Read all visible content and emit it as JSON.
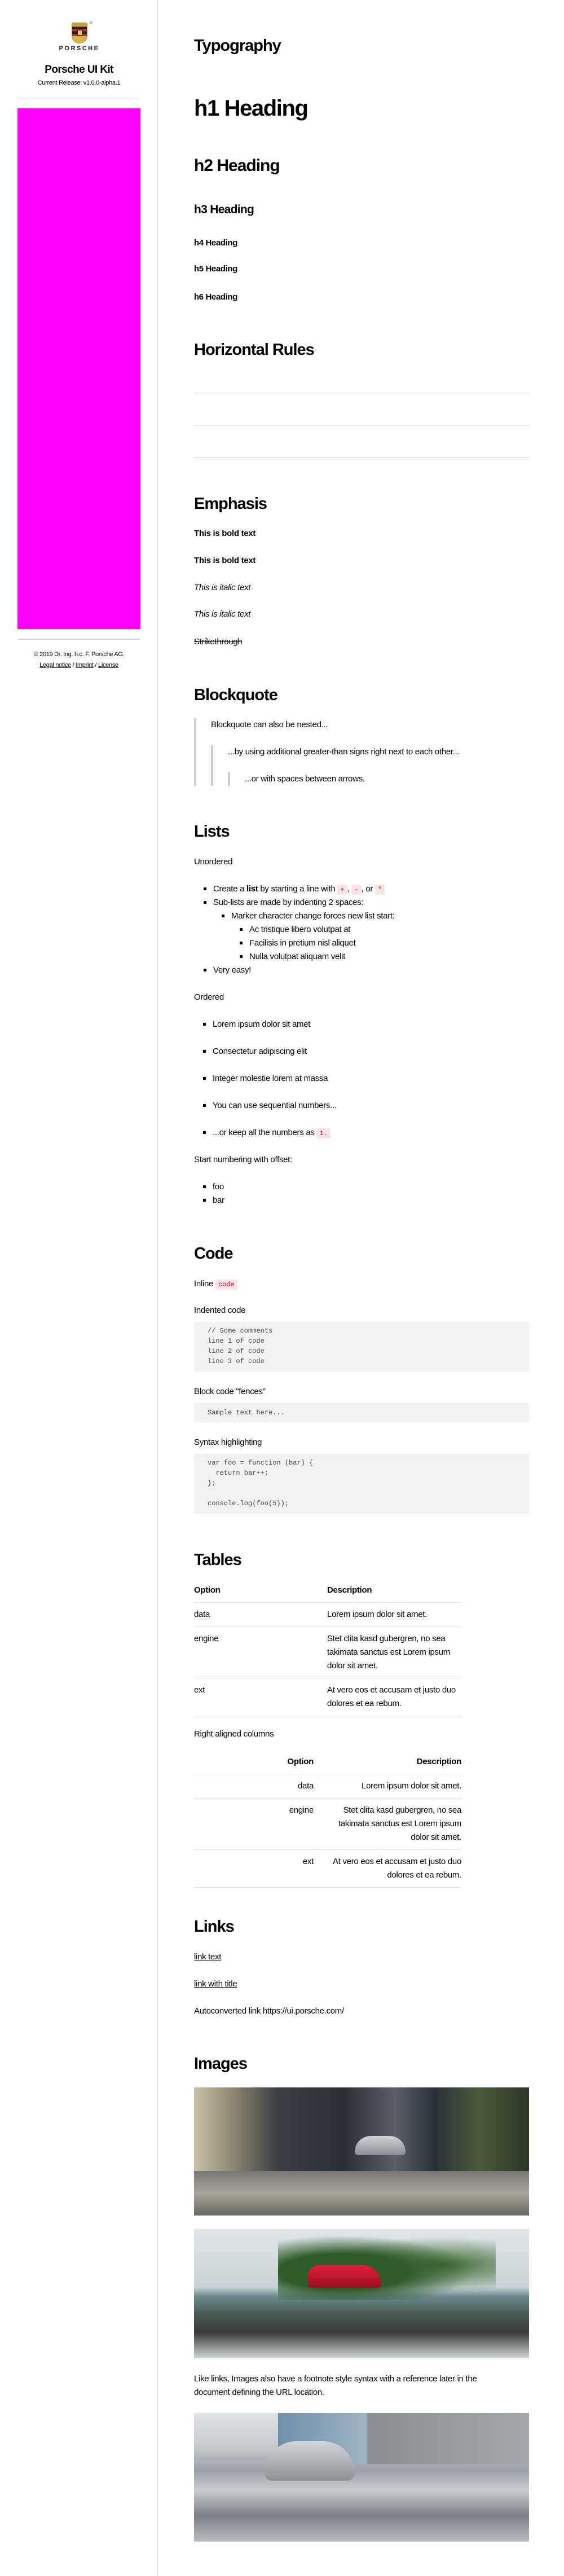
{
  "sidebar": {
    "logo_wordmark": "PORSCHE",
    "logo_registered": "®",
    "title": "Porsche UI Kit",
    "release": "Current Release: v1.0.0-alpha.1",
    "nav_color": "#ff00ff",
    "copyright": "© 2019 Dr. Ing. h.c. F. Porsche AG.",
    "links": [
      "Legal notice",
      "Imprint",
      "License"
    ],
    "separator": "/"
  },
  "typography": {
    "title": "Typography",
    "h1": "h1 Heading",
    "h2": "h2 Heading",
    "h3": "h3 Heading",
    "h4": "h4 Heading",
    "h5": "h5 Heading",
    "h6": "h6 Heading"
  },
  "rules": {
    "title": "Horizontal Rules"
  },
  "emphasis": {
    "title": "Emphasis",
    "bold1": "This is bold text",
    "bold2": "This is bold text",
    "italic1": "This is italic text",
    "italic2": "This is italic text",
    "strike": "Strikethrough"
  },
  "blockquote": {
    "title": "Blockquote",
    "level1": "Blockquote can also be nested...",
    "level2": "...by using additional greater-than signs right next to each other...",
    "level3": "...or with spaces between arrows."
  },
  "lists": {
    "title": "Lists",
    "unordered_label": "Unordered",
    "item1": {
      "pre": "Create a ",
      "bold": "list",
      "mid": " by starting a line with ",
      "c1": "+",
      "s1": ", ",
      "c2": "-",
      "s2": ", or ",
      "c3": "*"
    },
    "unordered": [
      "Sub-lists are made by indenting 2 spaces:",
      "Marker character change forces new list start:",
      "Ac tristique libero volutpat at",
      "Facilisis in pretium nisl aliquet",
      "Nulla volutpat aliquam velit",
      "Very easy!"
    ],
    "ordered_label": "Ordered",
    "ordered": [
      "Lorem ipsum dolor sit amet",
      "Consectetur adipiscing elit",
      "Integer molestie lorem at massa",
      "You can use sequential numbers..."
    ],
    "ordered_last": {
      "text": "...or keep all the numbers as ",
      "code": "1."
    },
    "offset_label": "Start numbering with offset:",
    "offset": [
      "foo",
      "bar"
    ]
  },
  "code": {
    "title": "Code",
    "inline_label": "Inline",
    "inline_code": "code",
    "indented_label": "Indented code",
    "indented": "// Some comments\nline 1 of code\nline 2 of code\nline 3 of code",
    "fences_label": "Block code \"fences\"",
    "fences": "Sample text here...",
    "syntax_label": "Syntax highlighting",
    "syntax": "var foo = function (bar) {\n  return bar++;\n};\n\nconsole.log(foo(5));"
  },
  "tables": {
    "title": "Tables",
    "headers": [
      "Option",
      "Description"
    ],
    "rows": [
      [
        "data",
        "Lorem ipsum dolor sit amet."
      ],
      [
        "engine",
        "Stet clita kasd gubergren, no sea takimata sanctus est Lorem ipsum dolor sit amet."
      ],
      [
        "ext",
        "At vero eos et accusam et justo duo dolores et ea rebum."
      ]
    ],
    "right_label": "Right aligned columns"
  },
  "links": {
    "title": "Links",
    "link1": "link text",
    "link2": "link with title",
    "auto": "Autoconverted link https://ui.porsche.com/"
  },
  "images": {
    "title": "Images",
    "caption": "Like links, Images also have a footnote style syntax with a reference later in the document defining the URL location."
  }
}
